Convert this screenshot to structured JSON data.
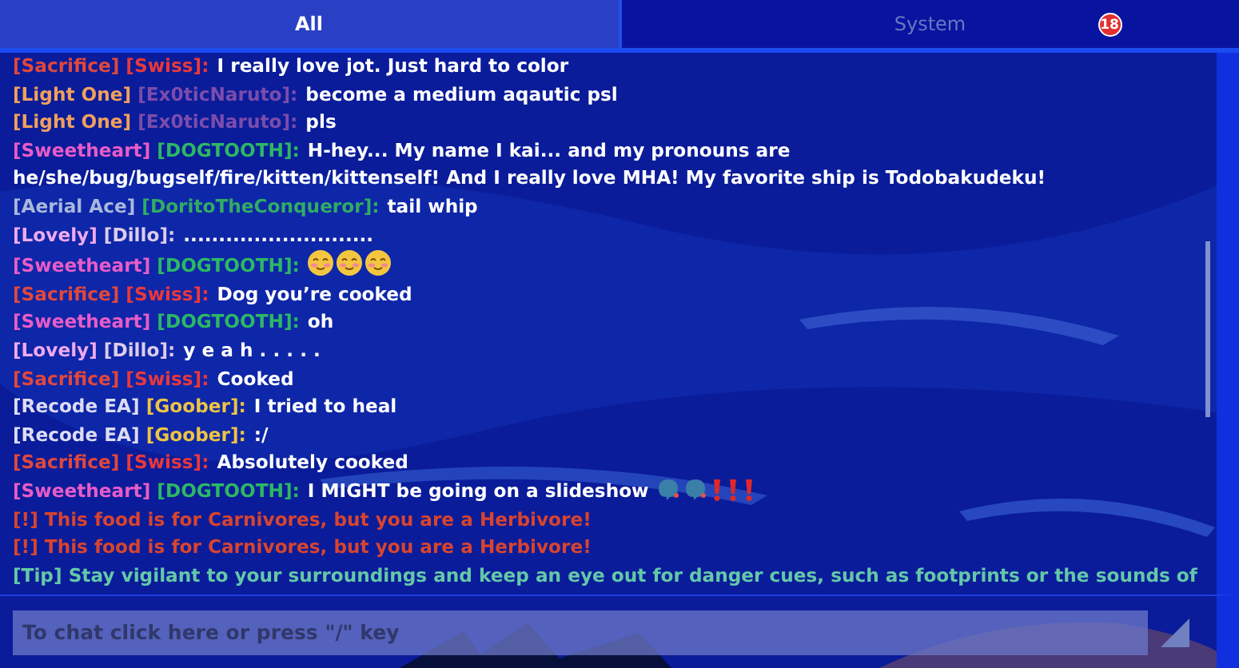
{
  "tabs": [
    {
      "label": "All",
      "selected": true
    },
    {
      "label": "System",
      "selected": false,
      "badge": "18"
    }
  ],
  "messages": [
    {
      "parts": [
        {
          "kind": "tag",
          "text": "[Sacrifice]",
          "color": "#e0483c"
        },
        {
          "kind": "name",
          "text": "[Swiss]:",
          "color": "#e8383c"
        },
        {
          "kind": "message",
          "text": "I really love jot. Just hard to color",
          "color": "#ffffff"
        }
      ]
    },
    {
      "parts": [
        {
          "kind": "tag",
          "text": "[Light One]",
          "color": "#f0a05c"
        },
        {
          "kind": "name",
          "text": "[Ex0ticNaruto]:",
          "color": "#7c4cac"
        },
        {
          "kind": "message",
          "text": "become a medium aqautic psl",
          "color": "#ffffff"
        }
      ]
    },
    {
      "parts": [
        {
          "kind": "tag",
          "text": "[Light One]",
          "color": "#f0a05c"
        },
        {
          "kind": "name",
          "text": "[Ex0ticNaruto]:",
          "color": "#7c4cac"
        },
        {
          "kind": "message",
          "text": "pls",
          "color": "#ffffff"
        }
      ]
    },
    {
      "parts": [
        {
          "kind": "tag",
          "text": "[Sweetheart]",
          "color": "#e85cc8"
        },
        {
          "kind": "name",
          "text": "[DOGTOOTH]:",
          "color": "#2cb864"
        },
        {
          "kind": "message",
          "text": "H-hey... My name I kai... and my pronouns are",
          "color": "#ffffff"
        },
        {
          "kind": "continuation",
          "text": "he/she/bug/bugself/fire/kitten/kittenself! And I really love MHA! My favorite ship is Todobakudeku!",
          "color": "#ffffff"
        }
      ]
    },
    {
      "parts": [
        {
          "kind": "tag",
          "text": "[Aerial Ace]",
          "color": "#a8b8dc"
        },
        {
          "kind": "name",
          "text": "[DoritoTheConqueror]:",
          "color": "#30ac64"
        },
        {
          "kind": "message",
          "text": "tail whip",
          "color": "#ffffff"
        }
      ]
    },
    {
      "parts": [
        {
          "kind": "tag",
          "text": "[Lovely]",
          "color": "#eeaaee"
        },
        {
          "kind": "name",
          "text": "[Dillo]:",
          "color": "#dccce8"
        },
        {
          "kind": "message",
          "text": "...........................",
          "color": "#ffffff"
        }
      ]
    },
    {
      "parts": [
        {
          "kind": "tag",
          "text": "[Sweetheart]",
          "color": "#e85cc8"
        },
        {
          "kind": "name",
          "text": "[DOGTOOTH]:",
          "color": "#2cb864"
        }
      ],
      "icons": [
        {
          "kind": "smiley"
        },
        {
          "kind": "smiley"
        },
        {
          "kind": "smiley"
        }
      ]
    },
    {
      "parts": [
        {
          "kind": "tag",
          "text": "[Sacrifice]",
          "color": "#e0483c"
        },
        {
          "kind": "name",
          "text": "[Swiss]:",
          "color": "#e8383c"
        },
        {
          "kind": "message",
          "text": "Dog you’re cooked",
          "color": "#ffffff"
        }
      ]
    },
    {
      "parts": [
        {
          "kind": "tag",
          "text": "[Sweetheart]",
          "color": "#e85cc8"
        },
        {
          "kind": "name",
          "text": "[DOGTOOTH]:",
          "color": "#2cb864"
        },
        {
          "kind": "message",
          "text": "oh",
          "color": "#ffffff"
        }
      ]
    },
    {
      "parts": [
        {
          "kind": "tag",
          "text": "[Lovely]",
          "color": "#eeaaee"
        },
        {
          "kind": "name",
          "text": "[Dillo]:",
          "color": "#dccce8"
        },
        {
          "kind": "message",
          "text": "y e a h . . . . .",
          "color": "#ffffff"
        }
      ]
    },
    {
      "parts": [
        {
          "kind": "tag",
          "text": "[Sacrifice]",
          "color": "#e0483c"
        },
        {
          "kind": "name",
          "text": "[Swiss]:",
          "color": "#e8383c"
        },
        {
          "kind": "message",
          "text": "Cooked",
          "color": "#ffffff"
        }
      ]
    },
    {
      "parts": [
        {
          "kind": "tag",
          "text": "[Recode EA]",
          "color": "#dcdcf4"
        },
        {
          "kind": "name",
          "text": "[Goober]:",
          "color": "#ecc444"
        },
        {
          "kind": "message",
          "text": "I tried to heal",
          "color": "#ffffff"
        }
      ]
    },
    {
      "parts": [
        {
          "kind": "tag",
          "text": "[Recode EA]",
          "color": "#dcdcf4"
        },
        {
          "kind": "name",
          "text": "[Goober]:",
          "color": "#ecc444"
        },
        {
          "kind": "message",
          "text": ":/",
          "color": "#ffffff"
        }
      ]
    },
    {
      "parts": [
        {
          "kind": "tag",
          "text": "[Sacrifice]",
          "color": "#e0483c"
        },
        {
          "kind": "name",
          "text": "[Swiss]:",
          "color": "#e8383c"
        },
        {
          "kind": "message",
          "text": "Absolutely cooked",
          "color": "#ffffff"
        }
      ]
    },
    {
      "parts": [
        {
          "kind": "tag",
          "text": "[Sweetheart]",
          "color": "#e85cc8"
        },
        {
          "kind": "name",
          "text": "[DOGTOOTH]:",
          "color": "#2cb864"
        },
        {
          "kind": "message",
          "text": "I MIGHT be going on a slideshow",
          "color": "#ffffff"
        }
      ],
      "icons": [
        {
          "kind": "blob"
        },
        {
          "kind": "blob"
        },
        {
          "kind": "exclamation"
        },
        {
          "kind": "exclamation"
        },
        {
          "kind": "exclamation"
        }
      ]
    },
    {
      "parts": [
        {
          "kind": "system",
          "text": "[!] This food is for Carnivores, but you are a Herbivore!",
          "color": "#d8442e"
        }
      ]
    },
    {
      "parts": [
        {
          "kind": "system",
          "text": "[!] This food is for Carnivores, but you are a Herbivore!",
          "color": "#d8442e"
        }
      ]
    },
    {
      "parts": [
        {
          "kind": "tip",
          "text": "[Tip] Stay vigilant to your surroundings and keep an eye out for danger cues, such as footprints or the sounds of",
          "color": "#64c8a8"
        }
      ]
    }
  ],
  "input": {
    "placeholder": "To chat click here or press \"/\" key"
  }
}
